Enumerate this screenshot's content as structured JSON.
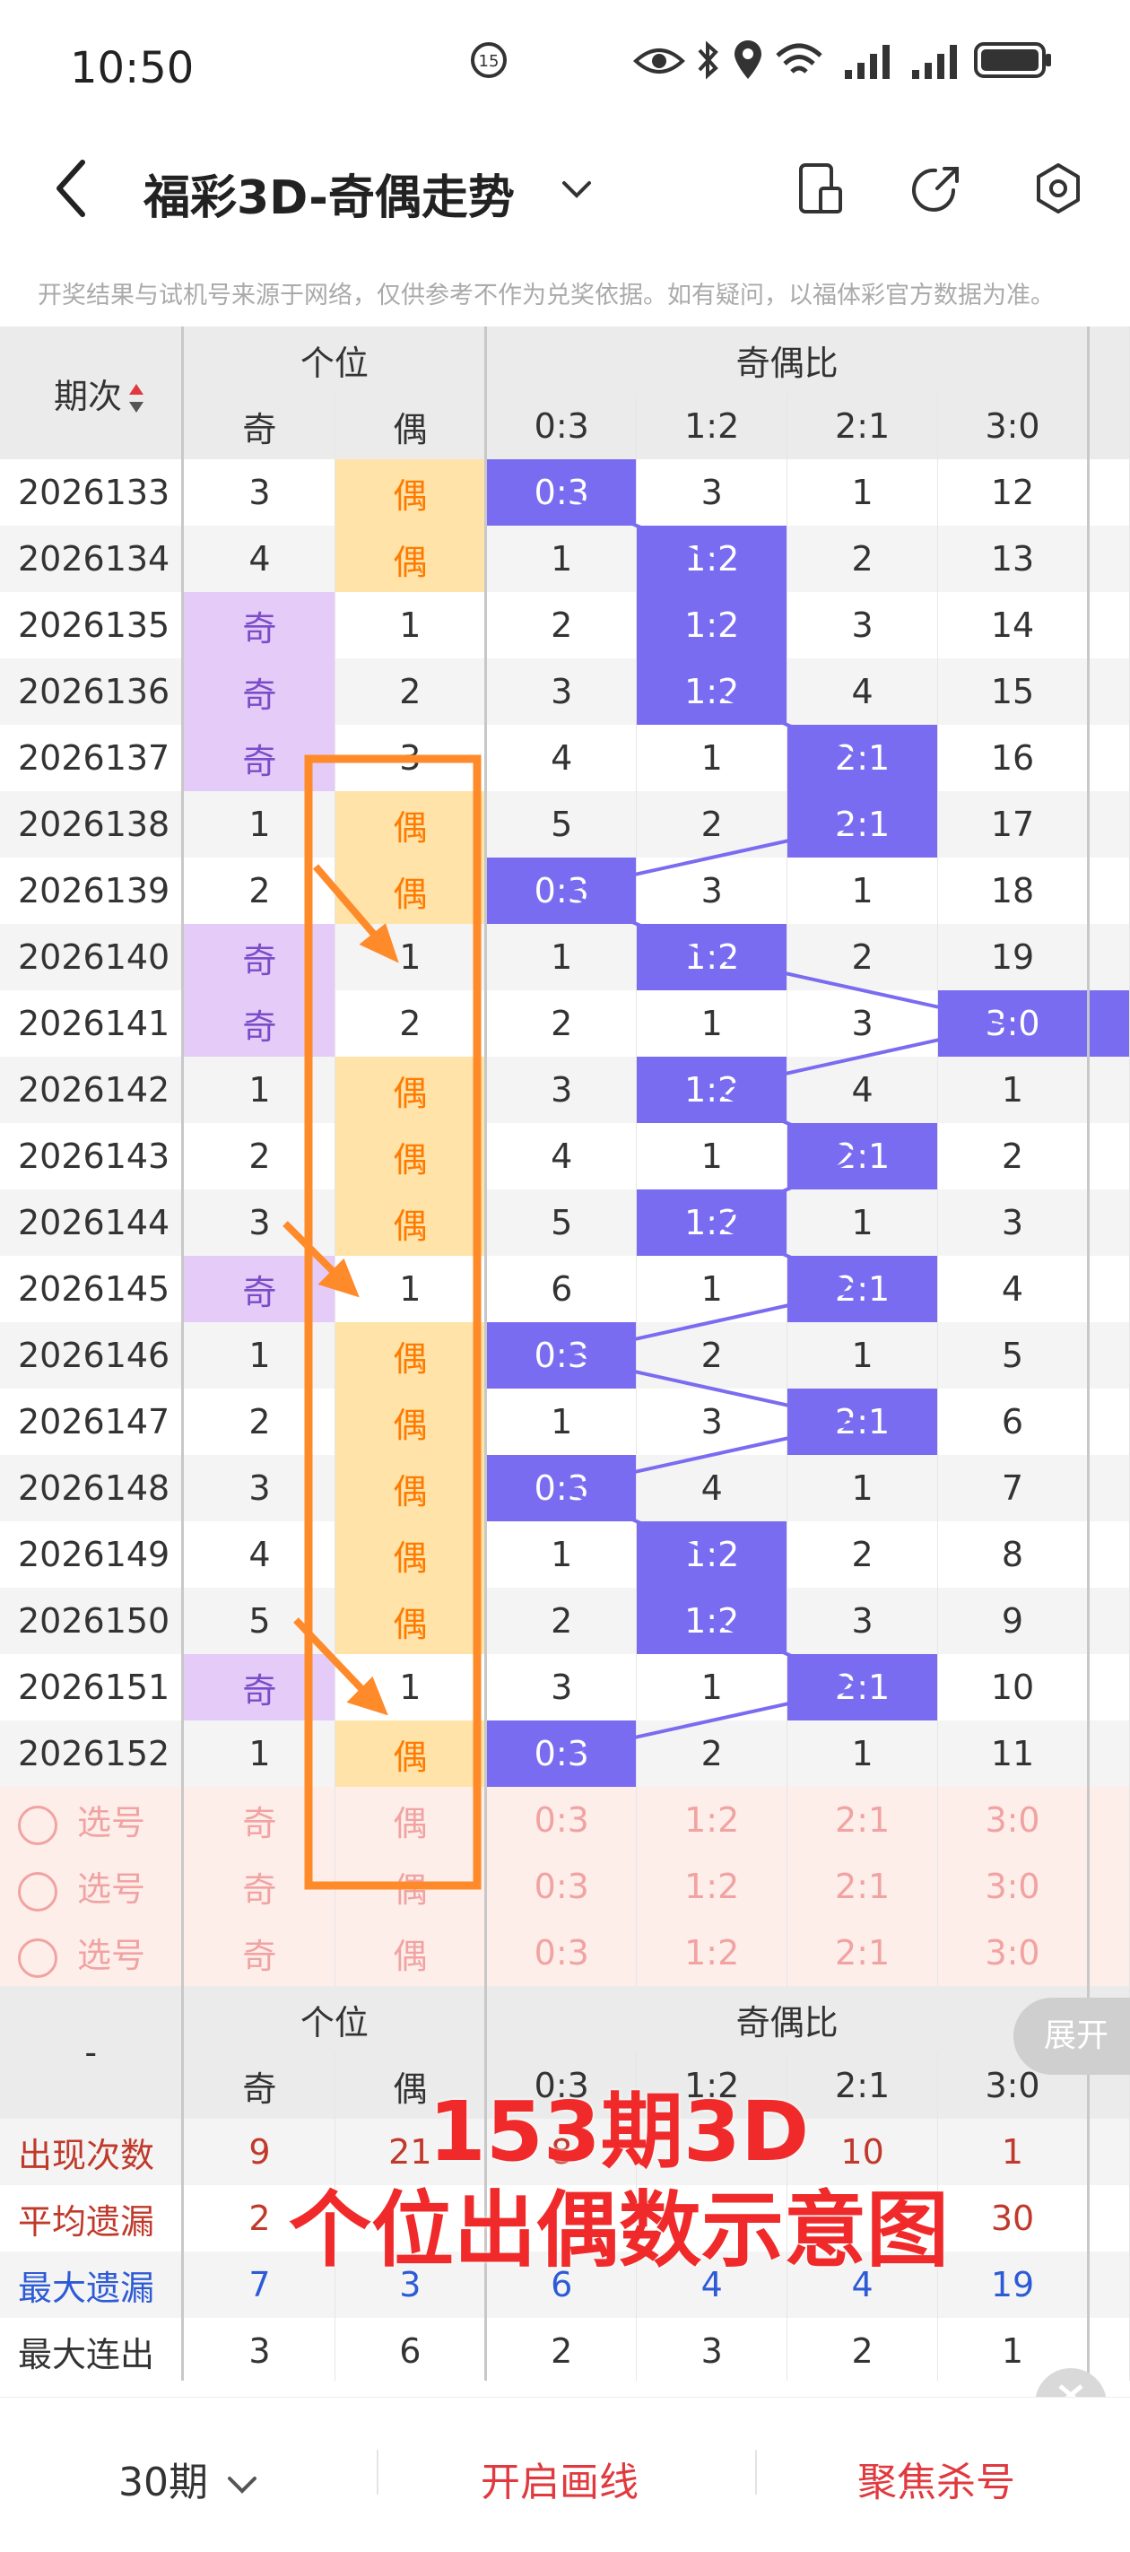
{
  "status_bar": {
    "time": "10:50"
  },
  "header": {
    "title": "福彩3D-奇偶走势"
  },
  "disclaimer": "开奖结果与试机号来源于网络，仅供参考不作为兑奖依据。如有疑问，以福体彩官方数据为准。",
  "table": {
    "period_header": "期次",
    "group_digit": "个位",
    "group_ratio": "奇偶比",
    "sub_odd": "奇",
    "sub_even": "偶",
    "ratio_headers": [
      "0:3",
      "1:2",
      "2:1",
      "3:0"
    ],
    "rows": [
      {
        "p": "2026133",
        "odd": "3",
        "even": "偶",
        "r": [
          "0:3",
          "3",
          "1",
          "12"
        ],
        "hit": "even",
        "ratio_hit": 0
      },
      {
        "p": "2026134",
        "odd": "4",
        "even": "偶",
        "r": [
          "1",
          "1:2",
          "2",
          "13"
        ],
        "hit": "even",
        "ratio_hit": 1
      },
      {
        "p": "2026135",
        "odd": "奇",
        "even": "1",
        "r": [
          "2",
          "1:2",
          "3",
          "14"
        ],
        "hit": "odd",
        "ratio_hit": 1
      },
      {
        "p": "2026136",
        "odd": "奇",
        "even": "2",
        "r": [
          "3",
          "1:2",
          "4",
          "15"
        ],
        "hit": "odd",
        "ratio_hit": 1
      },
      {
        "p": "2026137",
        "odd": "奇",
        "even": "3",
        "r": [
          "4",
          "1",
          "2:1",
          "16"
        ],
        "hit": "odd",
        "ratio_hit": 2
      },
      {
        "p": "2026138",
        "odd": "1",
        "even": "偶",
        "r": [
          "5",
          "2",
          "2:1",
          "17"
        ],
        "hit": "even",
        "ratio_hit": 2
      },
      {
        "p": "2026139",
        "odd": "2",
        "even": "偶",
        "r": [
          "0:3",
          "3",
          "1",
          "18"
        ],
        "hit": "even",
        "ratio_hit": 0
      },
      {
        "p": "2026140",
        "odd": "奇",
        "even": "1",
        "r": [
          "1",
          "1:2",
          "2",
          "19"
        ],
        "hit": "odd",
        "ratio_hit": 1
      },
      {
        "p": "2026141",
        "odd": "奇",
        "even": "2",
        "r": [
          "2",
          "1",
          "3",
          "3:0"
        ],
        "hit": "odd",
        "ratio_hit": 3
      },
      {
        "p": "2026142",
        "odd": "1",
        "even": "偶",
        "r": [
          "3",
          "1:2",
          "4",
          "1"
        ],
        "hit": "even",
        "ratio_hit": 1
      },
      {
        "p": "2026143",
        "odd": "2",
        "even": "偶",
        "r": [
          "4",
          "1",
          "2:1",
          "2"
        ],
        "hit": "even",
        "ratio_hit": 2
      },
      {
        "p": "2026144",
        "odd": "3",
        "even": "偶",
        "r": [
          "5",
          "1:2",
          "1",
          "3"
        ],
        "hit": "even",
        "ratio_hit": 1
      },
      {
        "p": "2026145",
        "odd": "奇",
        "even": "1",
        "r": [
          "6",
          "1",
          "2:1",
          "4"
        ],
        "hit": "odd",
        "ratio_hit": 2
      },
      {
        "p": "2026146",
        "odd": "1",
        "even": "偶",
        "r": [
          "0:3",
          "2",
          "1",
          "5"
        ],
        "hit": "even",
        "ratio_hit": 0
      },
      {
        "p": "2026147",
        "odd": "2",
        "even": "偶",
        "r": [
          "1",
          "3",
          "2:1",
          "6"
        ],
        "hit": "even",
        "ratio_hit": 2
      },
      {
        "p": "2026148",
        "odd": "3",
        "even": "偶",
        "r": [
          "0:3",
          "4",
          "1",
          "7"
        ],
        "hit": "even",
        "ratio_hit": 0
      },
      {
        "p": "2026149",
        "odd": "4",
        "even": "偶",
        "r": [
          "1",
          "1:2",
          "2",
          "8"
        ],
        "hit": "even",
        "ratio_hit": 1
      },
      {
        "p": "2026150",
        "odd": "5",
        "even": "偶",
        "r": [
          "2",
          "1:2",
          "3",
          "9"
        ],
        "hit": "even",
        "ratio_hit": 1
      },
      {
        "p": "2026151",
        "odd": "奇",
        "even": "1",
        "r": [
          "3",
          "1",
          "2:1",
          "10"
        ],
        "hit": "odd",
        "ratio_hit": 2
      },
      {
        "p": "2026152",
        "odd": "1",
        "even": "偶",
        "r": [
          "0:3",
          "2",
          "1",
          "11"
        ],
        "hit": "even",
        "ratio_hit": 0
      }
    ],
    "pick_label": "选号",
    "pick_rows": [
      {
        "odd": "奇",
        "even": "偶",
        "r": [
          "0:3",
          "1:2",
          "2:1",
          "3:0"
        ]
      },
      {
        "odd": "奇",
        "even": "偶",
        "r": [
          "0:3",
          "1:2",
          "2:1",
          "3:0"
        ]
      },
      {
        "odd": "奇",
        "even": "偶",
        "r": [
          "0:3",
          "1:2",
          "2:1",
          "3:0"
        ]
      }
    ],
    "stats_dash": "-",
    "stats": [
      {
        "label": "出现次数",
        "vals": [
          "9",
          "21",
          "8",
          "",
          "10",
          "1"
        ],
        "cls": "red"
      },
      {
        "label": "平均遗漏",
        "vals": [
          "2",
          "",
          "",
          "",
          "",
          "30"
        ],
        "cls": "red"
      },
      {
        "label": "最大遗漏",
        "vals": [
          "7",
          "3",
          "6",
          "4",
          "4",
          "19"
        ],
        "cls": "blue"
      },
      {
        "label": "最大连出",
        "vals": [
          "3",
          "6",
          "2",
          "3",
          "2",
          "1"
        ],
        "cls": "plain"
      }
    ]
  },
  "annotation": {
    "line1": "153期3D",
    "line2": "个位出偶数示意图"
  },
  "expand_button": "展开",
  "bottom_bar": {
    "periods": "30期",
    "draw_lines": "开启画线",
    "focus_kill": "聚焦杀号"
  },
  "colors": {
    "odd_hit": "#e5cbf7",
    "even_hit": "#ffe3a8",
    "ratio_hit": "#7a6cf0",
    "annotation_orange": "#ff8a2a",
    "accent_red": "#e0393e"
  }
}
